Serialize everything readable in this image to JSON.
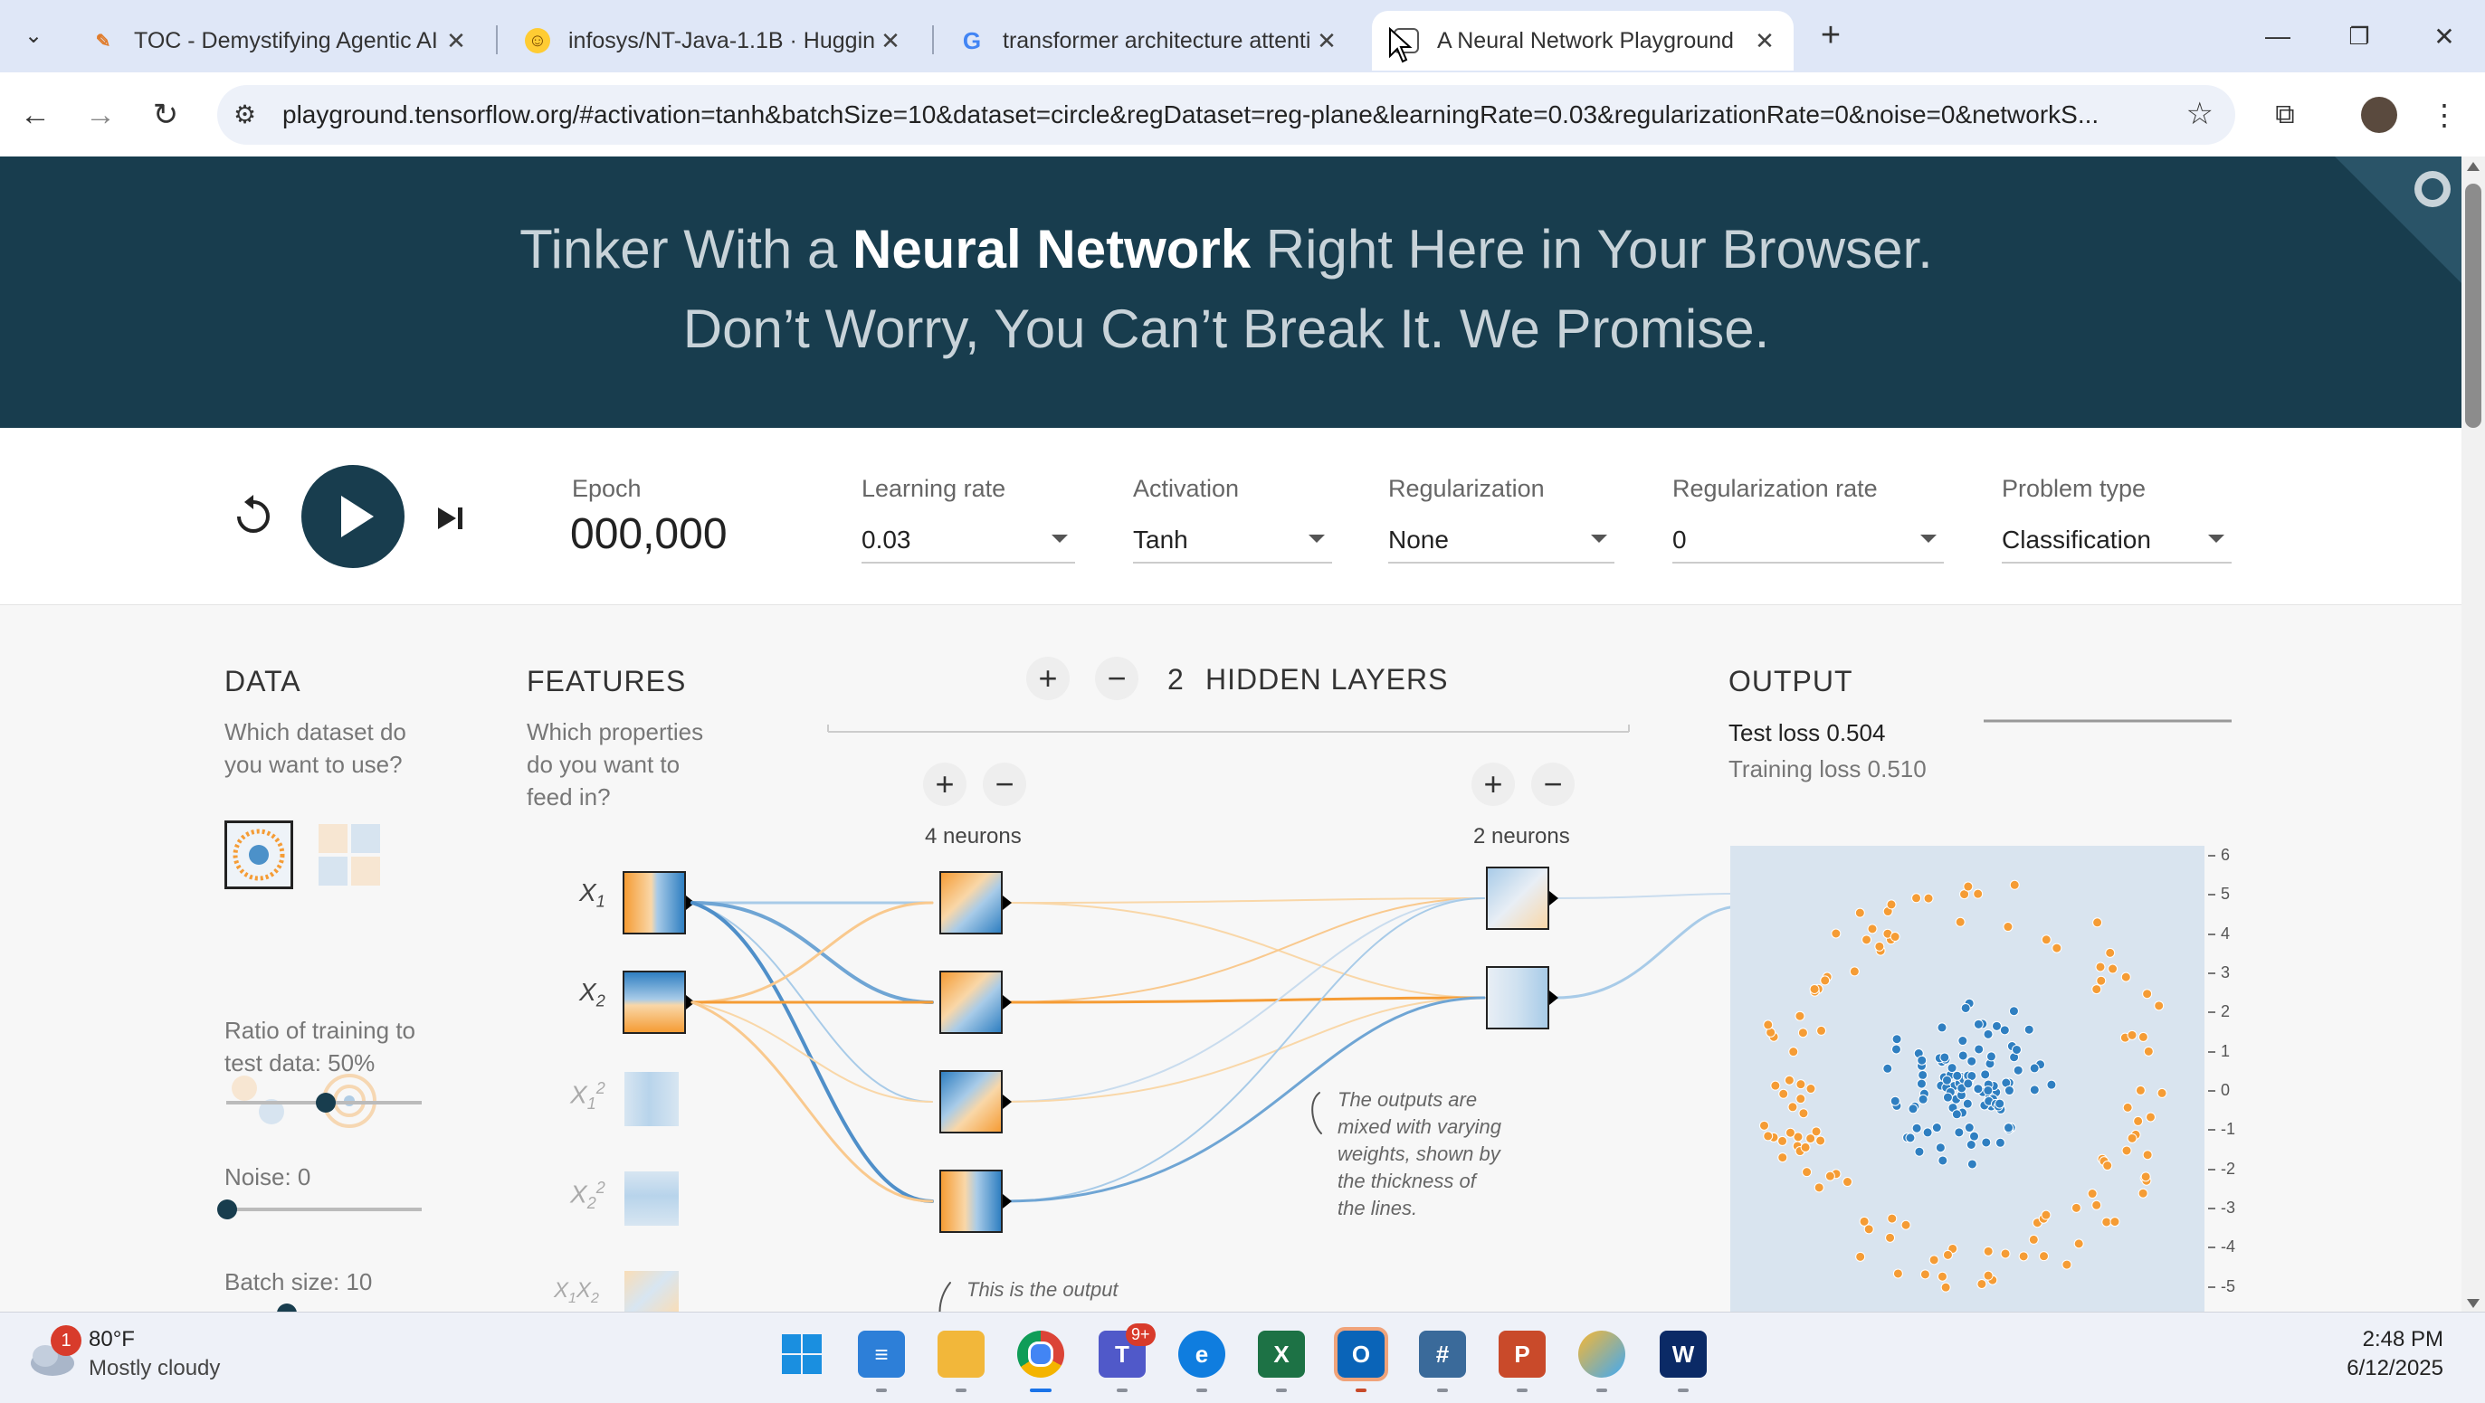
{
  "browser": {
    "tabs": [
      {
        "title": "TOC - Demystifying Agentic AI",
        "icon": "pencil-icon",
        "active": false
      },
      {
        "title": "infosys/NT-Java-1.1B · Hugging",
        "icon": "huggingface-icon",
        "active": false
      },
      {
        "title": "transformer architecture attenti",
        "icon": "google-icon",
        "active": false
      },
      {
        "title": "A Neural Network Playground",
        "icon": "playground-icon",
        "active": true
      }
    ],
    "url": "playground.tensorflow.org/#activation=tanh&batchSize=10&dataset=circle&regDataset=reg-plane&learningRate=0.03&regularizationRate=0&noise=0&networkS..."
  },
  "header": {
    "line1_pre": "Tinker With a ",
    "line1_bold": "Neural Network",
    "line1_post": " Right Here in Your Browser.",
    "line2": "Don’t Worry, You Can’t Break It. We Promise."
  },
  "controls": {
    "epoch_label": "Epoch",
    "epoch_value": "000,000",
    "learning_rate_label": "Learning rate",
    "learning_rate_value": "0.03",
    "activation_label": "Activation",
    "activation_value": "Tanh",
    "regularization_label": "Regularization",
    "regularization_value": "None",
    "regularization_rate_label": "Regularization rate",
    "regularization_rate_value": "0",
    "problem_type_label": "Problem type",
    "problem_type_value": "Classification"
  },
  "data_panel": {
    "title": "DATA",
    "question_line1": "Which dataset do",
    "question_line2": "you want to use?",
    "ratio_label_line1": "Ratio of training to",
    "ratio_label_line2": "test data:  50%",
    "ratio_value": 0.5,
    "noise_label": "Noise:  0",
    "noise_value": 0,
    "batch_label": "Batch size:  10"
  },
  "features": {
    "title": "FEATURES",
    "q1": "Which properties",
    "q2": "do you want to",
    "q3": "feed in?",
    "items": [
      "X",
      "X",
      "X",
      "X",
      "X X"
    ],
    "subs": [
      "1",
      "2",
      "1",
      "2",
      "1",
      "2"
    ],
    "sups": [
      "2",
      "2"
    ]
  },
  "network": {
    "layer_count": "2",
    "hidden_layers_label": "HIDDEN LAYERS",
    "layer1_neurons": "4 neurons",
    "layer2_neurons": "2 neurons",
    "note_weights_1": "The outputs are",
    "note_weights_2": "mixed with varying",
    "note_weights_3": "weights, shown by",
    "note_weights_4": "the thickness of",
    "note_weights_5": "the lines.",
    "note_output": "This is the output"
  },
  "output": {
    "title": "OUTPUT",
    "test_loss": "Test loss 0.504",
    "training_loss": "Training loss 0.510",
    "axis_ticks": [
      "6",
      "5",
      "4",
      "3",
      "2",
      "1",
      "0",
      "-1",
      "-2",
      "-3",
      "-4",
      "-5"
    ],
    "colors": {
      "blue": "#2f7fc1",
      "orange": "#f59c35",
      "bg": "#d9e4ef"
    }
  },
  "taskbar": {
    "weather_temp": "80°F",
    "weather_desc": "Mostly cloudy",
    "weather_badge": "1",
    "teams_badge": "9+",
    "time": "2:48 PM",
    "date": "6/12/2025"
  }
}
